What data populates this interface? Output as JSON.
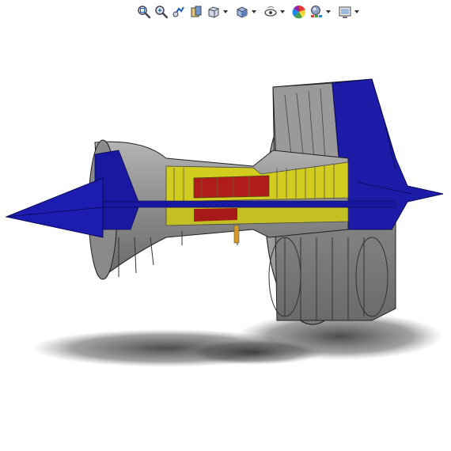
{
  "app": {
    "toolbar": {
      "icons": [
        "zoom-to-fit-icon",
        "zoom-to-area-icon",
        "previous-view-icon",
        "section-view-icon",
        "view-orientation-icon",
        "display-style-icon",
        "hide-show-items-icon",
        "edit-appearance-icon",
        "apply-scene-icon",
        "view-settings-icon"
      ]
    },
    "model": {
      "name": "turbofan-engine-section-view",
      "colors": {
        "casing": "#8c8c8c",
        "casing_dark": "#5a5a5a",
        "cone": "#1616a8",
        "compressor": "#d6d21e",
        "combustor": "#b41e1e",
        "shadow": "#3a3a3a"
      }
    }
  }
}
